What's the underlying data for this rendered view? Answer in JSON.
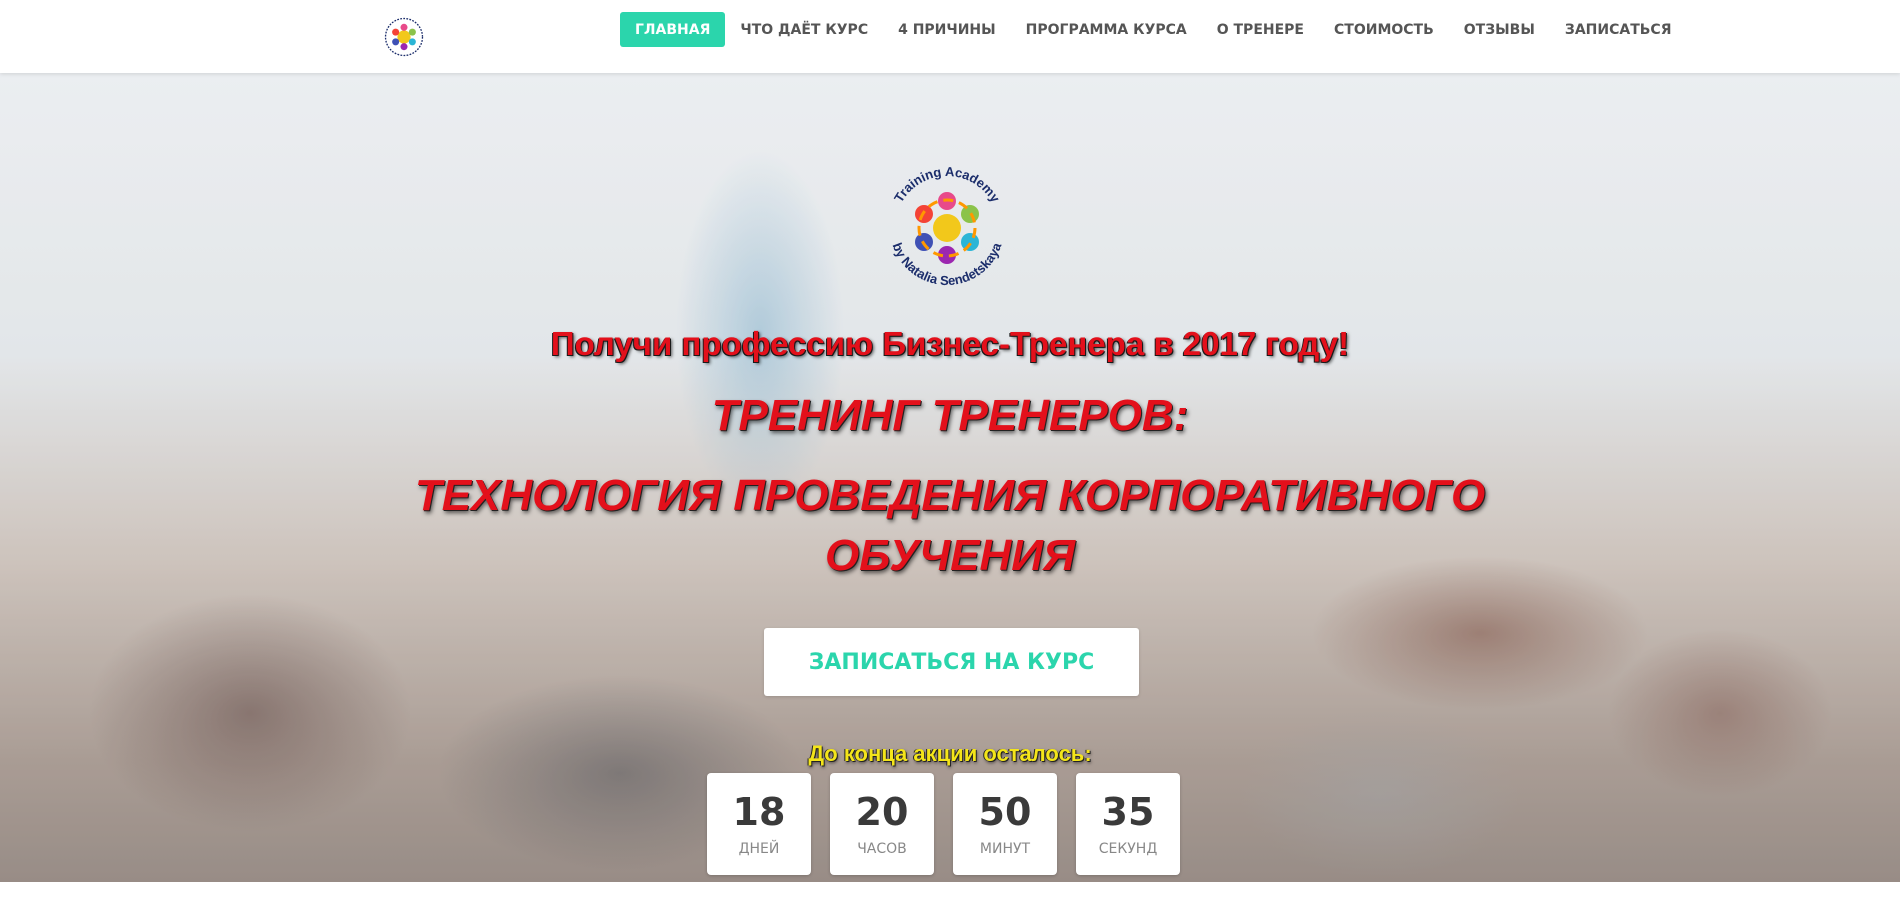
{
  "header": {
    "logo_alt": "Training Academy by Natalia Sendetskaya",
    "nav": [
      {
        "label": "ГЛАВНАЯ",
        "active": true
      },
      {
        "label": "ЧТО ДАЁТ КУРС",
        "active": false
      },
      {
        "label": "4 ПРИЧИНЫ",
        "active": false
      },
      {
        "label": "ПРОГРАММА КУРСА",
        "active": false
      },
      {
        "label": "О ТРЕНЕРЕ",
        "active": false
      },
      {
        "label": "СТОИМОСТЬ",
        "active": false
      },
      {
        "label": "ОТЗЫВЫ",
        "active": false
      },
      {
        "label": "ЗАПИСАТЬСЯ",
        "active": false
      }
    ]
  },
  "hero": {
    "logo_text_top": "Training Academy",
    "logo_text_bottom": "by Natalia Sendetskaya",
    "tagline": "Получи профессию Бизнес-Тренера в 2017 году!",
    "title_line1": "ТРЕНИНГ ТРЕНЕРОВ:",
    "title_line2": "ТЕХНОЛОГИЯ ПРОВЕДЕНИЯ КОРПОРАТИВНОГО ОБУЧЕНИЯ",
    "cta_label": "ЗАПИСАТЬСЯ НА КУРС",
    "countdown_label": "До конца акции осталось:",
    "countdown": [
      {
        "value": "18",
        "unit": "ДНЕЙ"
      },
      {
        "value": "20",
        "unit": "ЧАСОВ"
      },
      {
        "value": "50",
        "unit": "МИНУТ"
      },
      {
        "value": "35",
        "unit": "СЕКУНД"
      }
    ]
  },
  "colors": {
    "accent": "#2bd5ac",
    "headline_red": "#e3101b",
    "countdown_label_yellow": "#f4e51a",
    "logo_text_navy": "#1b2d6b"
  },
  "icons": {
    "logo": "training-academy-logo"
  }
}
